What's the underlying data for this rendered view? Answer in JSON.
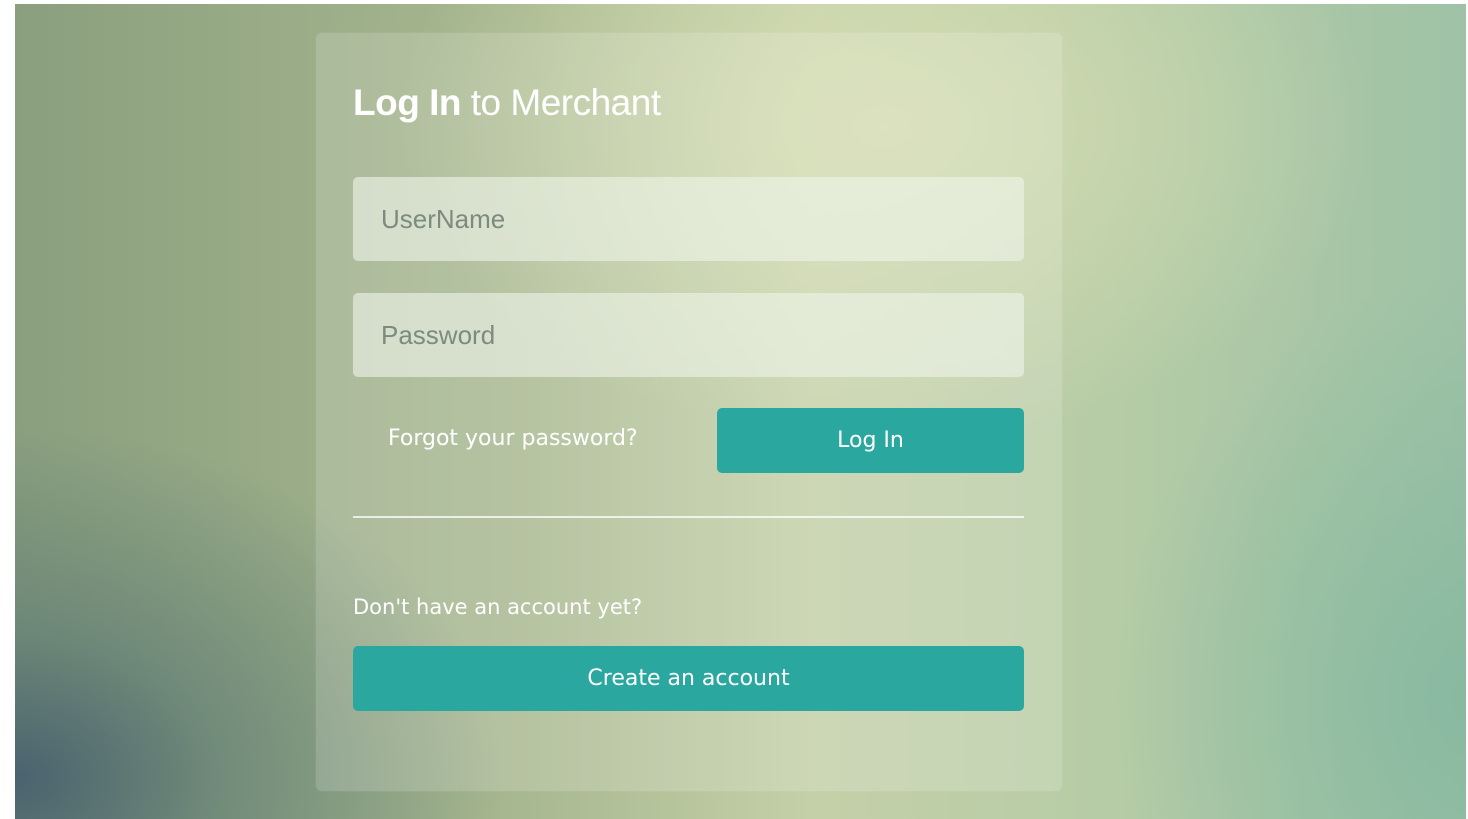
{
  "login": {
    "title_strong": "Log In",
    "title_rest": " to Merchant",
    "username_placeholder": "UserName",
    "password_placeholder": "Password",
    "forgot_label": "Forgot your password?",
    "login_button_label": "Log In",
    "no_account_label": "Don't have an account yet?",
    "create_account_label": "Create an account"
  },
  "colors": {
    "accent": "#2aa8a0",
    "text": "#ffffff"
  }
}
